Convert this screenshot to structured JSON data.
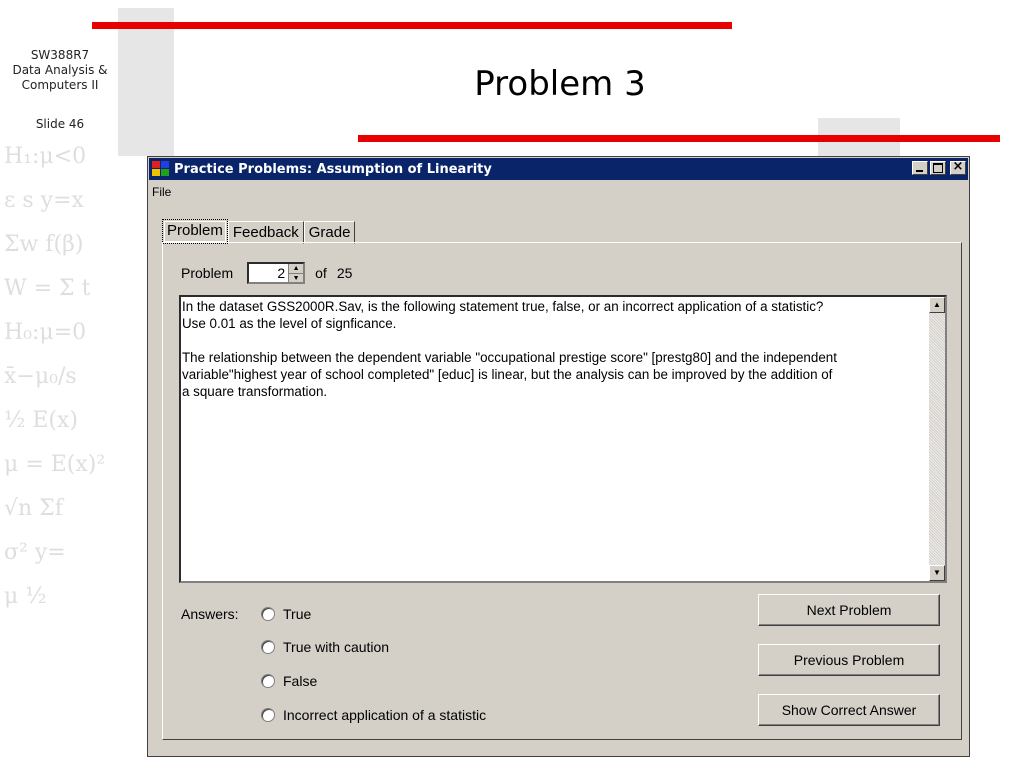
{
  "slide": {
    "course_line1": "SW388R7",
    "course_line2": "Data Analysis &",
    "course_line3": "Computers II",
    "slide_number": "Slide 46",
    "title": "Problem 3"
  },
  "window": {
    "title": "Practice Problems:  Assumption of Linearity",
    "menu_file": "File"
  },
  "tabs": [
    {
      "label": "Problem",
      "active": true
    },
    {
      "label": "Feedback",
      "active": false
    },
    {
      "label": "Grade",
      "active": false
    }
  ],
  "problem_nav": {
    "label": "Problem",
    "current": "2",
    "of_label": "of",
    "total": "25"
  },
  "problem_text": {
    "line1": "In the dataset GSS2000R.Sav, is the following statement true, false, or an incorrect application of a statistic?",
    "line2": "Use 0.01 as the level of signficance.",
    "line3": "The relationship between the dependent variable \"occupational prestige score\" [prestg80] and the independent",
    "line4": "variable\"highest year of school completed\" [educ] is linear, but the analysis can be improved by the addition of",
    "line5": "a square transformation."
  },
  "answers": {
    "label": "Answers:",
    "options": [
      "True",
      "True with caution",
      "False",
      "Incorrect application of a statistic"
    ]
  },
  "buttons": {
    "next": "Next Problem",
    "previous": "Previous Problem",
    "show_answer": "Show Correct Answer"
  },
  "colors": {
    "accent_red": "#e80000",
    "titlebar": "#0a246a",
    "window_face": "#d4d0c8"
  }
}
